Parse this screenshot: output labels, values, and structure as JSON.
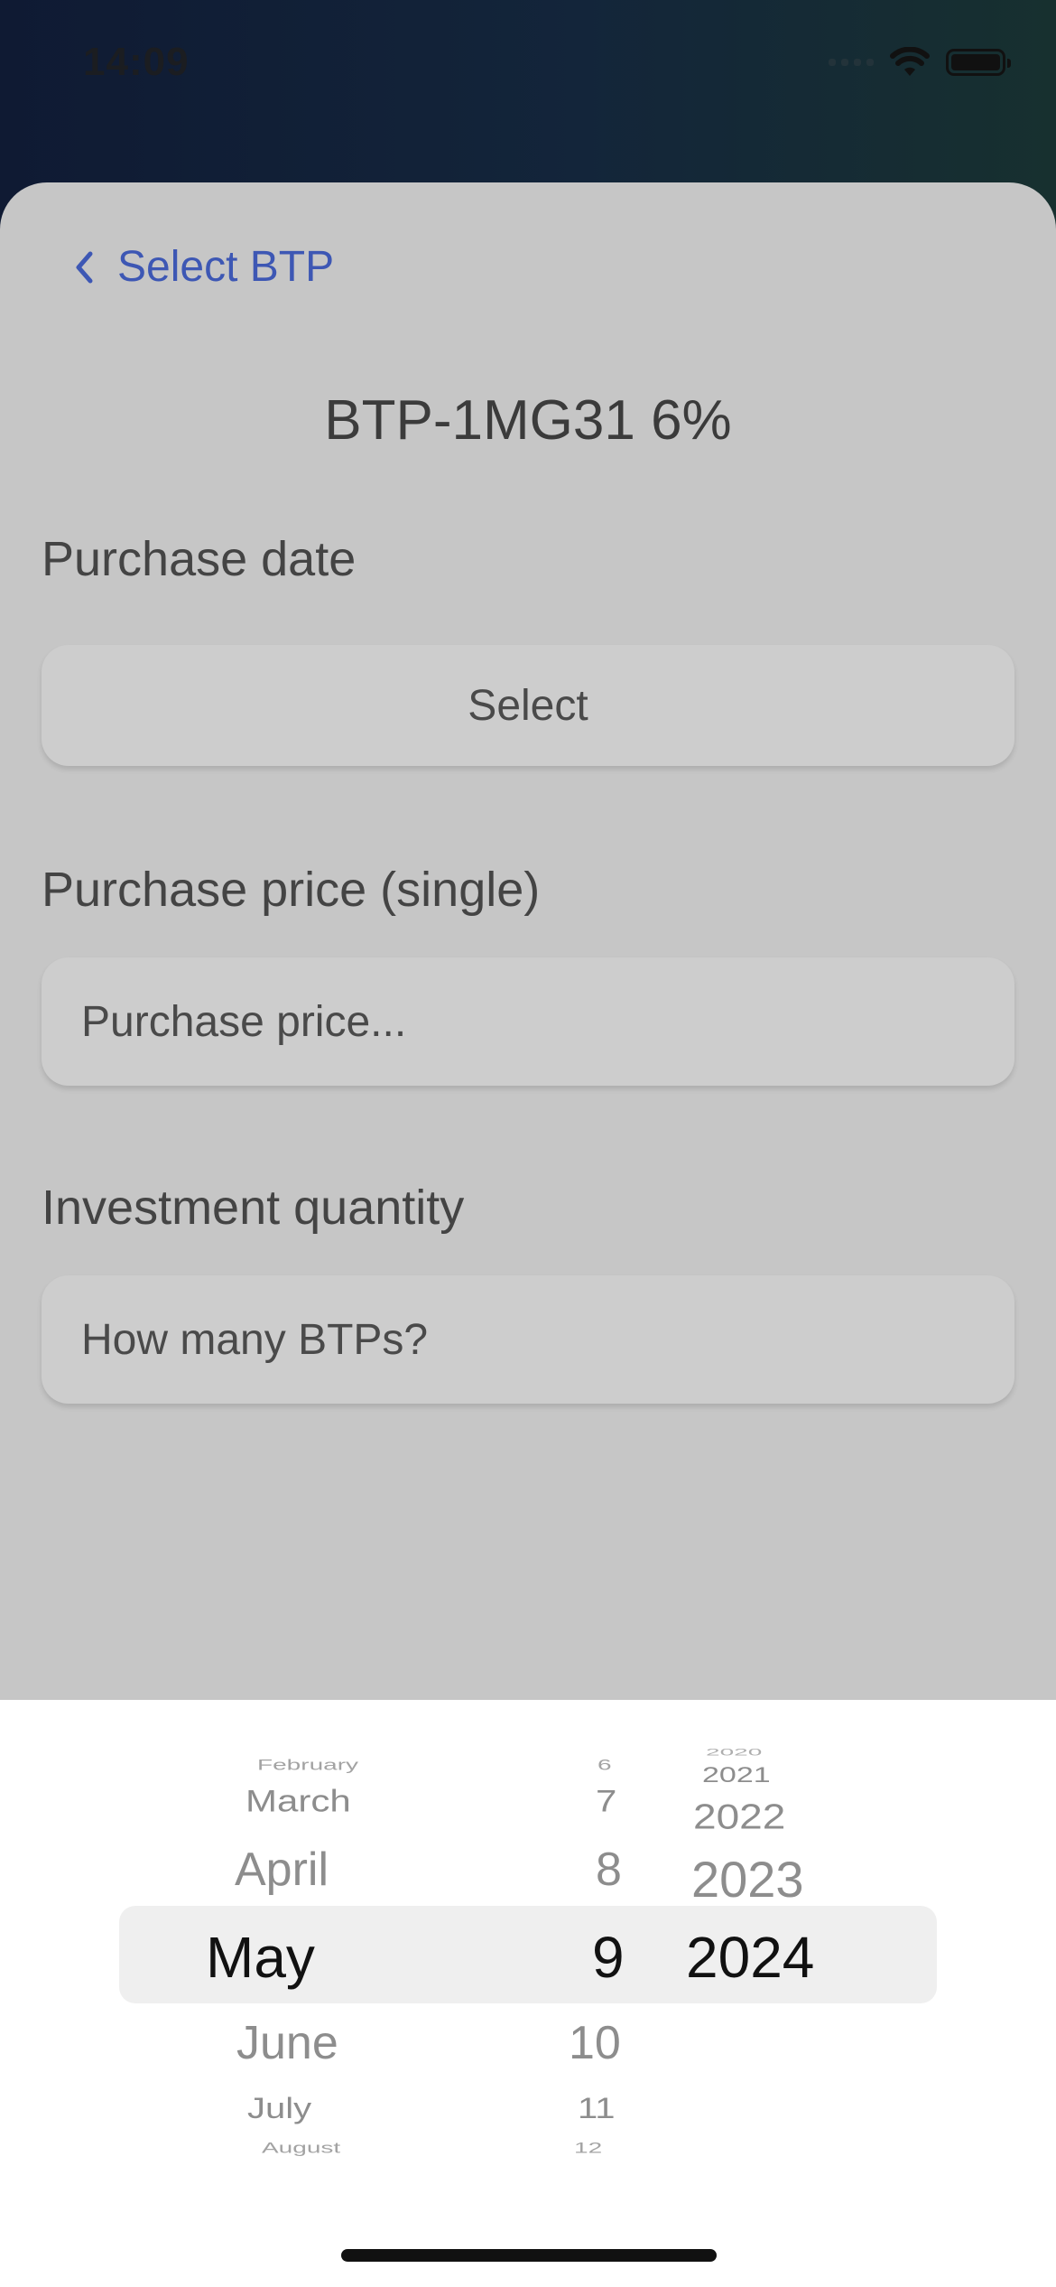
{
  "status_bar": {
    "time": "14:09"
  },
  "nav": {
    "back_label": "Select BTP"
  },
  "title": "BTP-1MG31 6%",
  "fields": {
    "purchase_date_label": "Purchase date",
    "purchase_date_button": "Select",
    "purchase_price_label": "Purchase price (single)",
    "purchase_price_placeholder": "Purchase price...",
    "quantity_label": "Investment quantity",
    "quantity_placeholder": "How many BTPs?"
  },
  "date_picker": {
    "months": [
      "February",
      "March",
      "April",
      "May",
      "June",
      "July",
      "August"
    ],
    "days": [
      "6",
      "7",
      "8",
      "9",
      "10",
      "11",
      "12"
    ],
    "years": [
      "2020",
      "2021",
      "2022",
      "2023",
      "2024"
    ],
    "selected": {
      "month": "May",
      "day": "9",
      "year": "2024"
    }
  }
}
